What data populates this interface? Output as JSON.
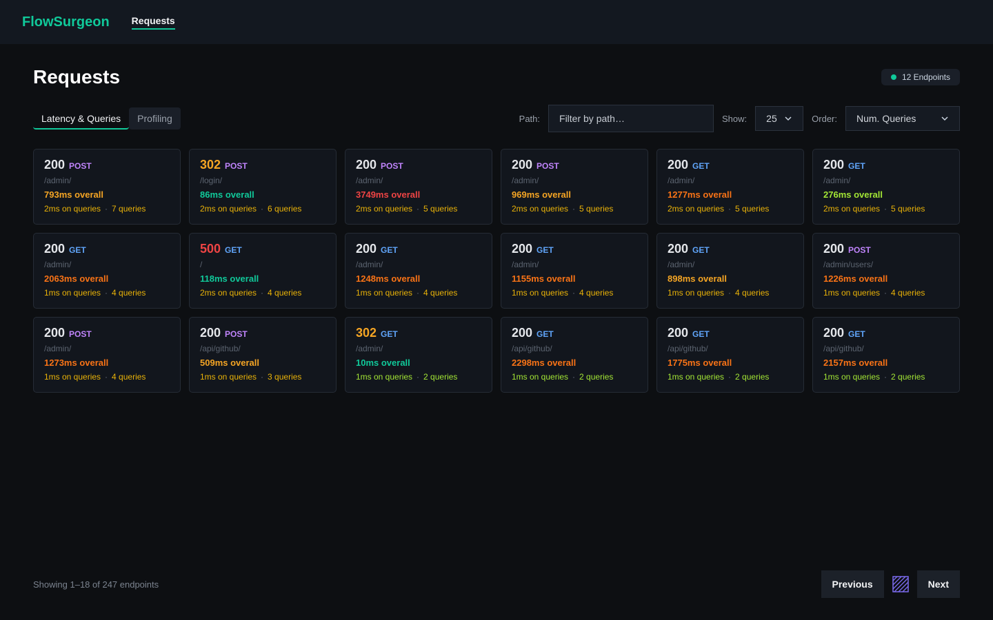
{
  "app": {
    "brand": "FlowSurgeon",
    "nav": "Requests"
  },
  "page": {
    "title": "Requests",
    "badge": "12 Endpoints"
  },
  "tabs": [
    {
      "label": "Latency & Queries"
    },
    {
      "label": "Profiling"
    }
  ],
  "filters": {
    "path_label": "Path:",
    "path_placeholder": "Filter by path…",
    "show_label": "Show:",
    "show_value": "25",
    "order_label": "Order:",
    "order_value": "Num. Queries"
  },
  "colors": {
    "accent": "#10c99a",
    "status_200": "#e5e7eb",
    "status_302": "#f5a524",
    "status_500": "#ef4444",
    "method_post": "#c084fc",
    "method_get": "#60a5fa",
    "lat_green": "#10c99a",
    "lat_lime": "#a3e635",
    "lat_amber": "#f5a524",
    "lat_orange": "#f97316",
    "lat_red": "#ef4444",
    "queries_amber": "#eab308",
    "queries_lime": "#a3e635"
  },
  "cards": [
    {
      "status": "200",
      "method": "POST",
      "path": "/admin/",
      "overall": "793ms overall",
      "queries_time": "2ms on queries",
      "queries": "7 queries",
      "lat": "lat_amber"
    },
    {
      "status": "302",
      "method": "POST",
      "path": "/login/",
      "overall": "86ms overall",
      "queries_time": "2ms on queries",
      "queries": "6 queries",
      "lat": "lat_green"
    },
    {
      "status": "200",
      "method": "POST",
      "path": "/admin/",
      "overall": "3749ms overall",
      "queries_time": "2ms on queries",
      "queries": "5 queries",
      "lat": "lat_red"
    },
    {
      "status": "200",
      "method": "POST",
      "path": "/admin/",
      "overall": "969ms overall",
      "queries_time": "2ms on queries",
      "queries": "5 queries",
      "lat": "lat_amber"
    },
    {
      "status": "200",
      "method": "GET",
      "path": "/admin/",
      "overall": "1277ms overall",
      "queries_time": "2ms on queries",
      "queries": "5 queries",
      "lat": "lat_orange"
    },
    {
      "status": "200",
      "method": "GET",
      "path": "/admin/",
      "overall": "276ms overall",
      "queries_time": "2ms on queries",
      "queries": "5 queries",
      "lat": "lat_lime"
    },
    {
      "status": "200",
      "method": "GET",
      "path": "/admin/",
      "overall": "2063ms overall",
      "queries_time": "1ms on queries",
      "queries": "4 queries",
      "lat": "lat_orange"
    },
    {
      "status": "500",
      "method": "GET",
      "path": "/",
      "overall": "118ms overall",
      "queries_time": "2ms on queries",
      "queries": "4 queries",
      "lat": "lat_green"
    },
    {
      "status": "200",
      "method": "GET",
      "path": "/admin/",
      "overall": "1248ms overall",
      "queries_time": "1ms on queries",
      "queries": "4 queries",
      "lat": "lat_orange"
    },
    {
      "status": "200",
      "method": "GET",
      "path": "/admin/",
      "overall": "1155ms overall",
      "queries_time": "1ms on queries",
      "queries": "4 queries",
      "lat": "lat_orange"
    },
    {
      "status": "200",
      "method": "GET",
      "path": "/admin/",
      "overall": "898ms overall",
      "queries_time": "1ms on queries",
      "queries": "4 queries",
      "lat": "lat_amber"
    },
    {
      "status": "200",
      "method": "POST",
      "path": "/admin/users/",
      "overall": "1226ms overall",
      "queries_time": "1ms on queries",
      "queries": "4 queries",
      "lat": "lat_orange"
    },
    {
      "status": "200",
      "method": "POST",
      "path": "/admin/",
      "overall": "1273ms overall",
      "queries_time": "1ms on queries",
      "queries": "4 queries",
      "lat": "lat_orange"
    },
    {
      "status": "200",
      "method": "POST",
      "path": "/api/github/",
      "overall": "509ms overall",
      "queries_time": "1ms on queries",
      "queries": "3 queries",
      "lat": "lat_amber"
    },
    {
      "status": "302",
      "method": "GET",
      "path": "/admin/",
      "overall": "10ms overall",
      "queries_time": "1ms on queries",
      "queries": "2 queries",
      "lat": "lat_green"
    },
    {
      "status": "200",
      "method": "GET",
      "path": "/api/github/",
      "overall": "2298ms overall",
      "queries_time": "1ms on queries",
      "queries": "2 queries",
      "lat": "lat_orange"
    },
    {
      "status": "200",
      "method": "GET",
      "path": "/api/github/",
      "overall": "1775ms overall",
      "queries_time": "1ms on queries",
      "queries": "2 queries",
      "lat": "lat_orange"
    },
    {
      "status": "200",
      "method": "GET",
      "path": "/api/github/",
      "overall": "2157ms overall",
      "queries_time": "1ms on queries",
      "queries": "2 queries",
      "lat": "lat_orange"
    }
  ],
  "footer": {
    "showing": "Showing 1–18 of 247 endpoints",
    "prev": "Previous",
    "next": "Next",
    "pattern_icon": "hatched-square-icon"
  }
}
